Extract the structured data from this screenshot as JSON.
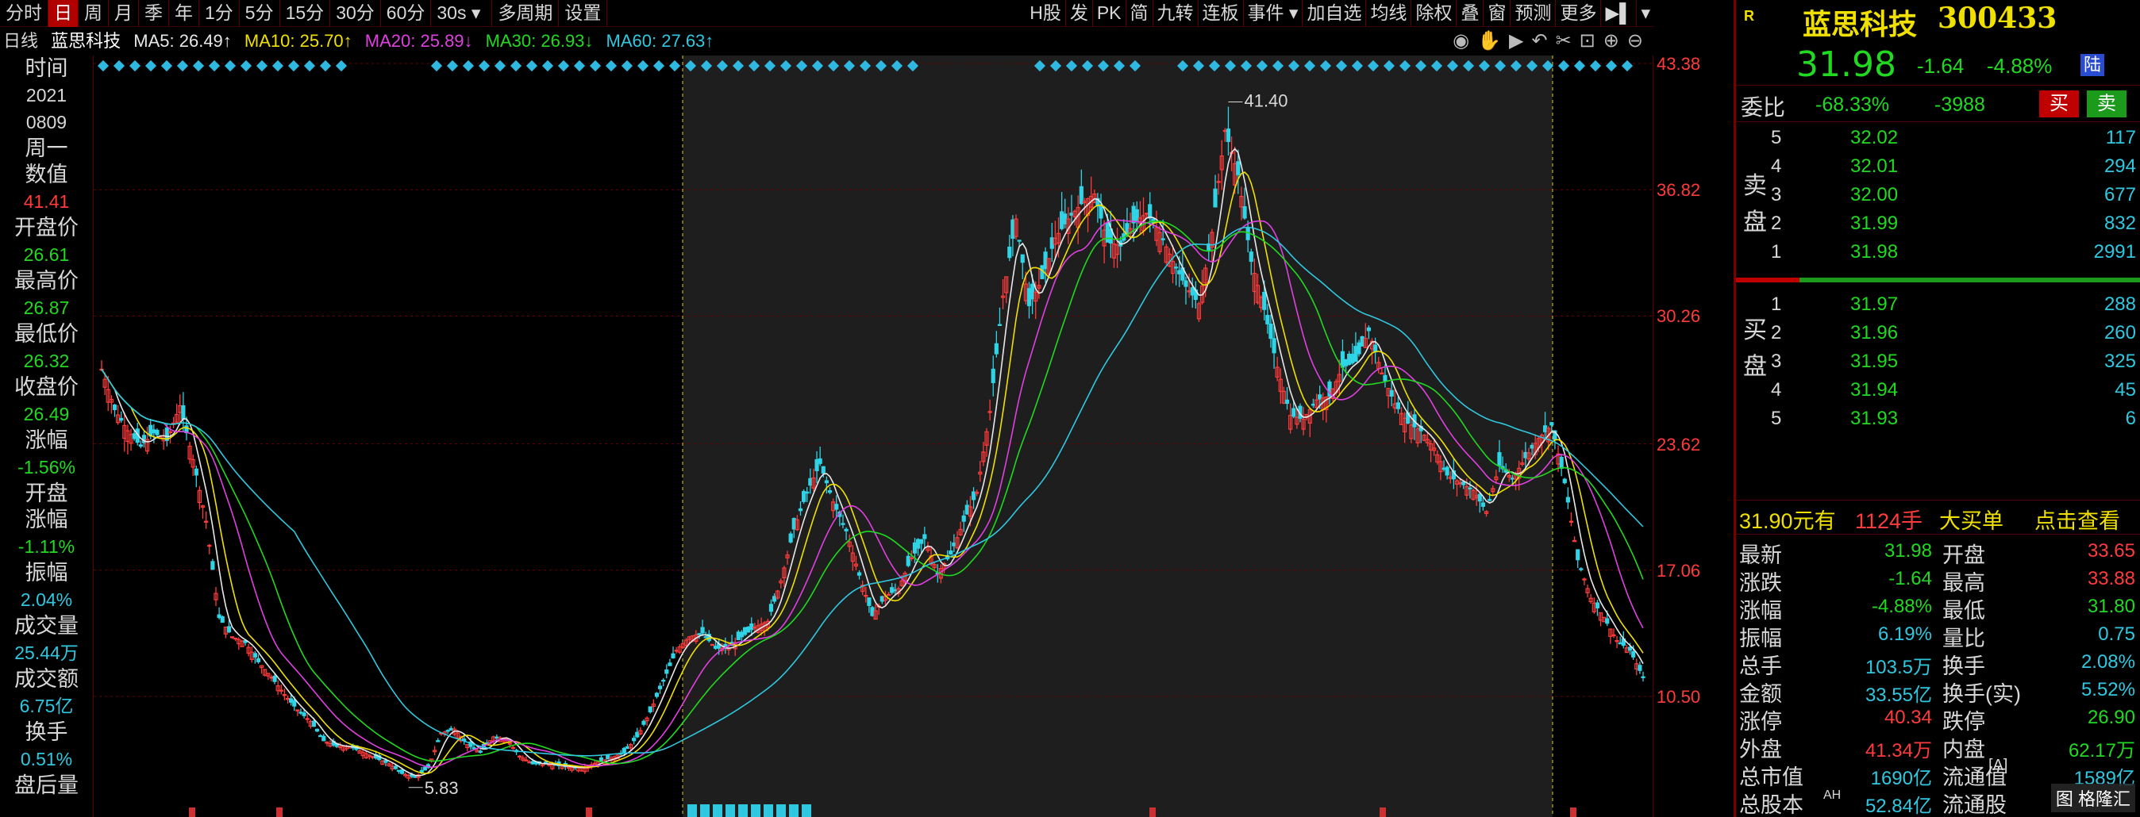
{
  "toolbar": {
    "items": [
      "分时",
      "日",
      "周",
      "月",
      "季",
      "年",
      "1分",
      "5分",
      "15分",
      "30分",
      "60分",
      "30s",
      "多周期",
      "设置"
    ],
    "active": "日",
    "right_items": [
      "H股",
      "发",
      "PK",
      "简",
      "九转",
      "连板",
      "事件",
      "加自选",
      "均线",
      "除权",
      "叠",
      "窗",
      "预测",
      "更多"
    ]
  },
  "ma_line": {
    "period": "日线",
    "stock_name": "蓝思科技",
    "ma5": "MA5: 26.49↑",
    "ma10": "MA10: 25.70↑",
    "ma20": "MA20: 25.89↓",
    "ma30": "MA30: 26.93↓",
    "ma60": "MA60: 27.63↑"
  },
  "left_panel": {
    "items": [
      {
        "label": "时间",
        "value": "2021",
        "value2": "0809",
        "value_color": "#d8d8d8"
      },
      {
        "label": "周一",
        "value": "",
        "value_color": "#d8d8d8"
      },
      {
        "label": "数值",
        "value": "41.41",
        "value_color": "#ff3b3b"
      },
      {
        "label": "开盘价",
        "value": "26.61",
        "value_color": "#21d921"
      },
      {
        "label": "最高价",
        "value": "26.87",
        "value_color": "#21d921"
      },
      {
        "label": "最低价",
        "value": "26.32",
        "value_color": "#21d921"
      },
      {
        "label": "收盘价",
        "value": "26.49",
        "value_color": "#21d921"
      },
      {
        "label": "涨幅",
        "value": "-1.56%",
        "value_color": "#21d921"
      },
      {
        "label": "开盘涨幅",
        "value": "-1.11%",
        "value_color": "#21d921"
      },
      {
        "label": "振幅",
        "value": "2.04%",
        "value_color": "#2fc8e0"
      },
      {
        "label": "成交量",
        "value": "25.44万",
        "value_color": "#2fc8e0"
      },
      {
        "label": "成交额",
        "value": "6.75亿",
        "value_color": "#2fc8e0"
      },
      {
        "label": "换手",
        "value": "0.51%",
        "value_color": "#2fc8e0"
      },
      {
        "label": "盘后量",
        "value": "",
        "value_color": "#2fc8e0"
      }
    ]
  },
  "chart_data": {
    "type": "candlestick",
    "title": "",
    "period": "日线",
    "y_ticks": [
      43.38,
      36.82,
      30.26,
      23.62,
      17.06,
      10.5
    ],
    "ylim": [
      10.5,
      43.38
    ],
    "annotations": [
      {
        "label": "41.40",
        "type": "high"
      },
      {
        "label": "5.83",
        "type": "low"
      }
    ],
    "close_series_approx": [
      27.5,
      25.4,
      24.3,
      23.5,
      24.2,
      23.8,
      25.6,
      22.8,
      19.6,
      14.6,
      13.6,
      13.3,
      12.3,
      11.5,
      10.6,
      9.8,
      9.2,
      8.2,
      7.9,
      7.9,
      7.6,
      7.3,
      7.0,
      6.5,
      6.3,
      6.8,
      8.6,
      8.8,
      8.0,
      7.6,
      8.4,
      8.3,
      7.4,
      7.0,
      7.0,
      6.9,
      6.8,
      6.8,
      7.1,
      7.3,
      7.6,
      8.4,
      9.7,
      11.3,
      12.9,
      13.6,
      13.8,
      13.0,
      13.0,
      13.6,
      14.1,
      14.4,
      16.5,
      19.2,
      21.1,
      22.6,
      20.6,
      19.1,
      16.8,
      14.7,
      15.7,
      16.1,
      17.7,
      18.7,
      16.9,
      17.9,
      19.6,
      21.1,
      25.3,
      31.3,
      35.3,
      30.8,
      32.2,
      34.3,
      35.3,
      36.1,
      36.6,
      34.1,
      33.9,
      35.1,
      35.6,
      34.6,
      33.1,
      31.8,
      30.9,
      34.6,
      39.9,
      37.6,
      33.1,
      30.6,
      27.6,
      25.1,
      24.9,
      25.9,
      26.1,
      27.6,
      27.9,
      29.5,
      27.3,
      25.7,
      24.7,
      24.3,
      23.4,
      22.0,
      21.6,
      21.2,
      20.1,
      22.5,
      21.8,
      22.9,
      23.9,
      24.6,
      21.6,
      17.6,
      15.6,
      14.6,
      13.4,
      12.9,
      11.5
    ],
    "ma_series": [
      "MA5",
      "MA10",
      "MA20",
      "MA30",
      "MA60"
    ],
    "colors": {
      "up": "#ff3b3b",
      "down": "#2fd4e6",
      "ma5": "#e8e8e8",
      "ma10": "#f0e000",
      "ma20": "#e040e0",
      "ma30": "#21d921",
      "ma60": "#2fc8e0"
    }
  },
  "right_panel": {
    "logo": "R",
    "stock_name": "蓝思科技",
    "stock_code": "300433",
    "price": "31.98",
    "change": "-1.64",
    "change_pct": "-4.88%",
    "market_badge": "陆",
    "webi_label": "委比",
    "webi_value": "-68.33%",
    "webi_diff": "-3988",
    "buy_btn": "买",
    "sell_btn": "卖",
    "sell_label": [
      "卖",
      "盘"
    ],
    "buy_label": [
      "买",
      "盘"
    ],
    "sell_orders": [
      {
        "level": "5",
        "price": "32.02",
        "volume": "117"
      },
      {
        "level": "4",
        "price": "32.01",
        "volume": "294"
      },
      {
        "level": "3",
        "price": "32.00",
        "volume": "677"
      },
      {
        "level": "2",
        "price": "31.99",
        "volume": "832"
      },
      {
        "level": "1",
        "price": "31.98",
        "volume": "2991"
      }
    ],
    "buy_orders": [
      {
        "level": "1",
        "price": "31.97",
        "volume": "288"
      },
      {
        "level": "2",
        "price": "31.96",
        "volume": "260"
      },
      {
        "level": "3",
        "price": "31.95",
        "volume": "325"
      },
      {
        "level": "4",
        "price": "31.94",
        "volume": "45"
      },
      {
        "level": "5",
        "price": "31.93",
        "volume": "6"
      }
    ],
    "big_order": {
      "price": "31.90元有",
      "volume": "1124手",
      "label": "大买单",
      "action": "点击查看"
    },
    "stats": [
      [
        "最新",
        "31.98",
        "#21d921",
        "开盘",
        "33.65",
        "#ff3b3b"
      ],
      [
        "涨跌",
        "-1.64",
        "#21d921",
        "最高",
        "33.88",
        "#ff3b3b"
      ],
      [
        "涨幅",
        "-4.88%",
        "#21d921",
        "最低",
        "31.80",
        "#21d921"
      ],
      [
        "振幅",
        "6.19%",
        "#2fc8e0",
        "量比",
        "0.75",
        "#2fc8e0"
      ],
      [
        "总手",
        "103.5万",
        "#2fc8e0",
        "换手",
        "2.08%",
        "#2fc8e0"
      ],
      [
        "金额",
        "33.55亿",
        "#2fc8e0",
        "换手(实)",
        "5.52%",
        "#2fc8e0"
      ],
      [
        "涨停",
        "40.34",
        "#ff3b3b",
        "跌停",
        "26.90",
        "#21d921"
      ],
      [
        "外盘",
        "41.34万",
        "#ff3b3b",
        "内盘",
        "62.17万",
        "#21d921"
      ],
      [
        "总市值",
        "1690亿",
        "#2fc8e0",
        "流通值",
        "1589亿",
        "#2fc8e0"
      ],
      [
        "总股本",
        "52.84亿",
        "#2fc8e0",
        "流通股",
        "",
        ""
      ]
    ],
    "ah_badge": "AH",
    "a_badge": "[A]",
    "brand": "图 格隆汇"
  }
}
